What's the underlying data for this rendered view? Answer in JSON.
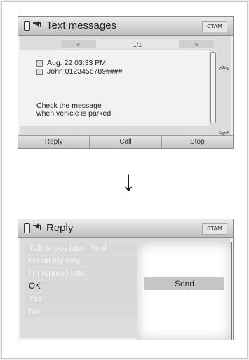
{
  "top_screen": {
    "title": "Text messages",
    "status_text": "0TAM",
    "pager": {
      "prev": "<",
      "page": "1/1",
      "next": ">"
    },
    "message": {
      "date": "Aug. 22 03:33 PM",
      "sender": "John 0123456789####",
      "body": "Check the message\nwhen vehicle is parked."
    },
    "buttons": {
      "reply": "Reply",
      "call": "Call",
      "stop": "Stop"
    }
  },
  "transition_arrow": "↓",
  "bottom_screen": {
    "title": "Reply",
    "status_text": "0TAM",
    "options": [
      "Talk to you later, I'm d",
      "I'm on my way",
      "I'm running late.",
      "OK",
      "Yes",
      "No"
    ],
    "popup": {
      "send": "Send"
    }
  },
  "colors": {
    "screen_bg": "#dcdcdc",
    "titlebar": "#bdbdbd",
    "text": "#222222"
  },
  "icons": [
    "phone-icon",
    "back-icon",
    "calendar-icon",
    "contact-icon",
    "chevron-up-icon",
    "chevron-down-icon",
    "down-arrow-icon"
  ]
}
